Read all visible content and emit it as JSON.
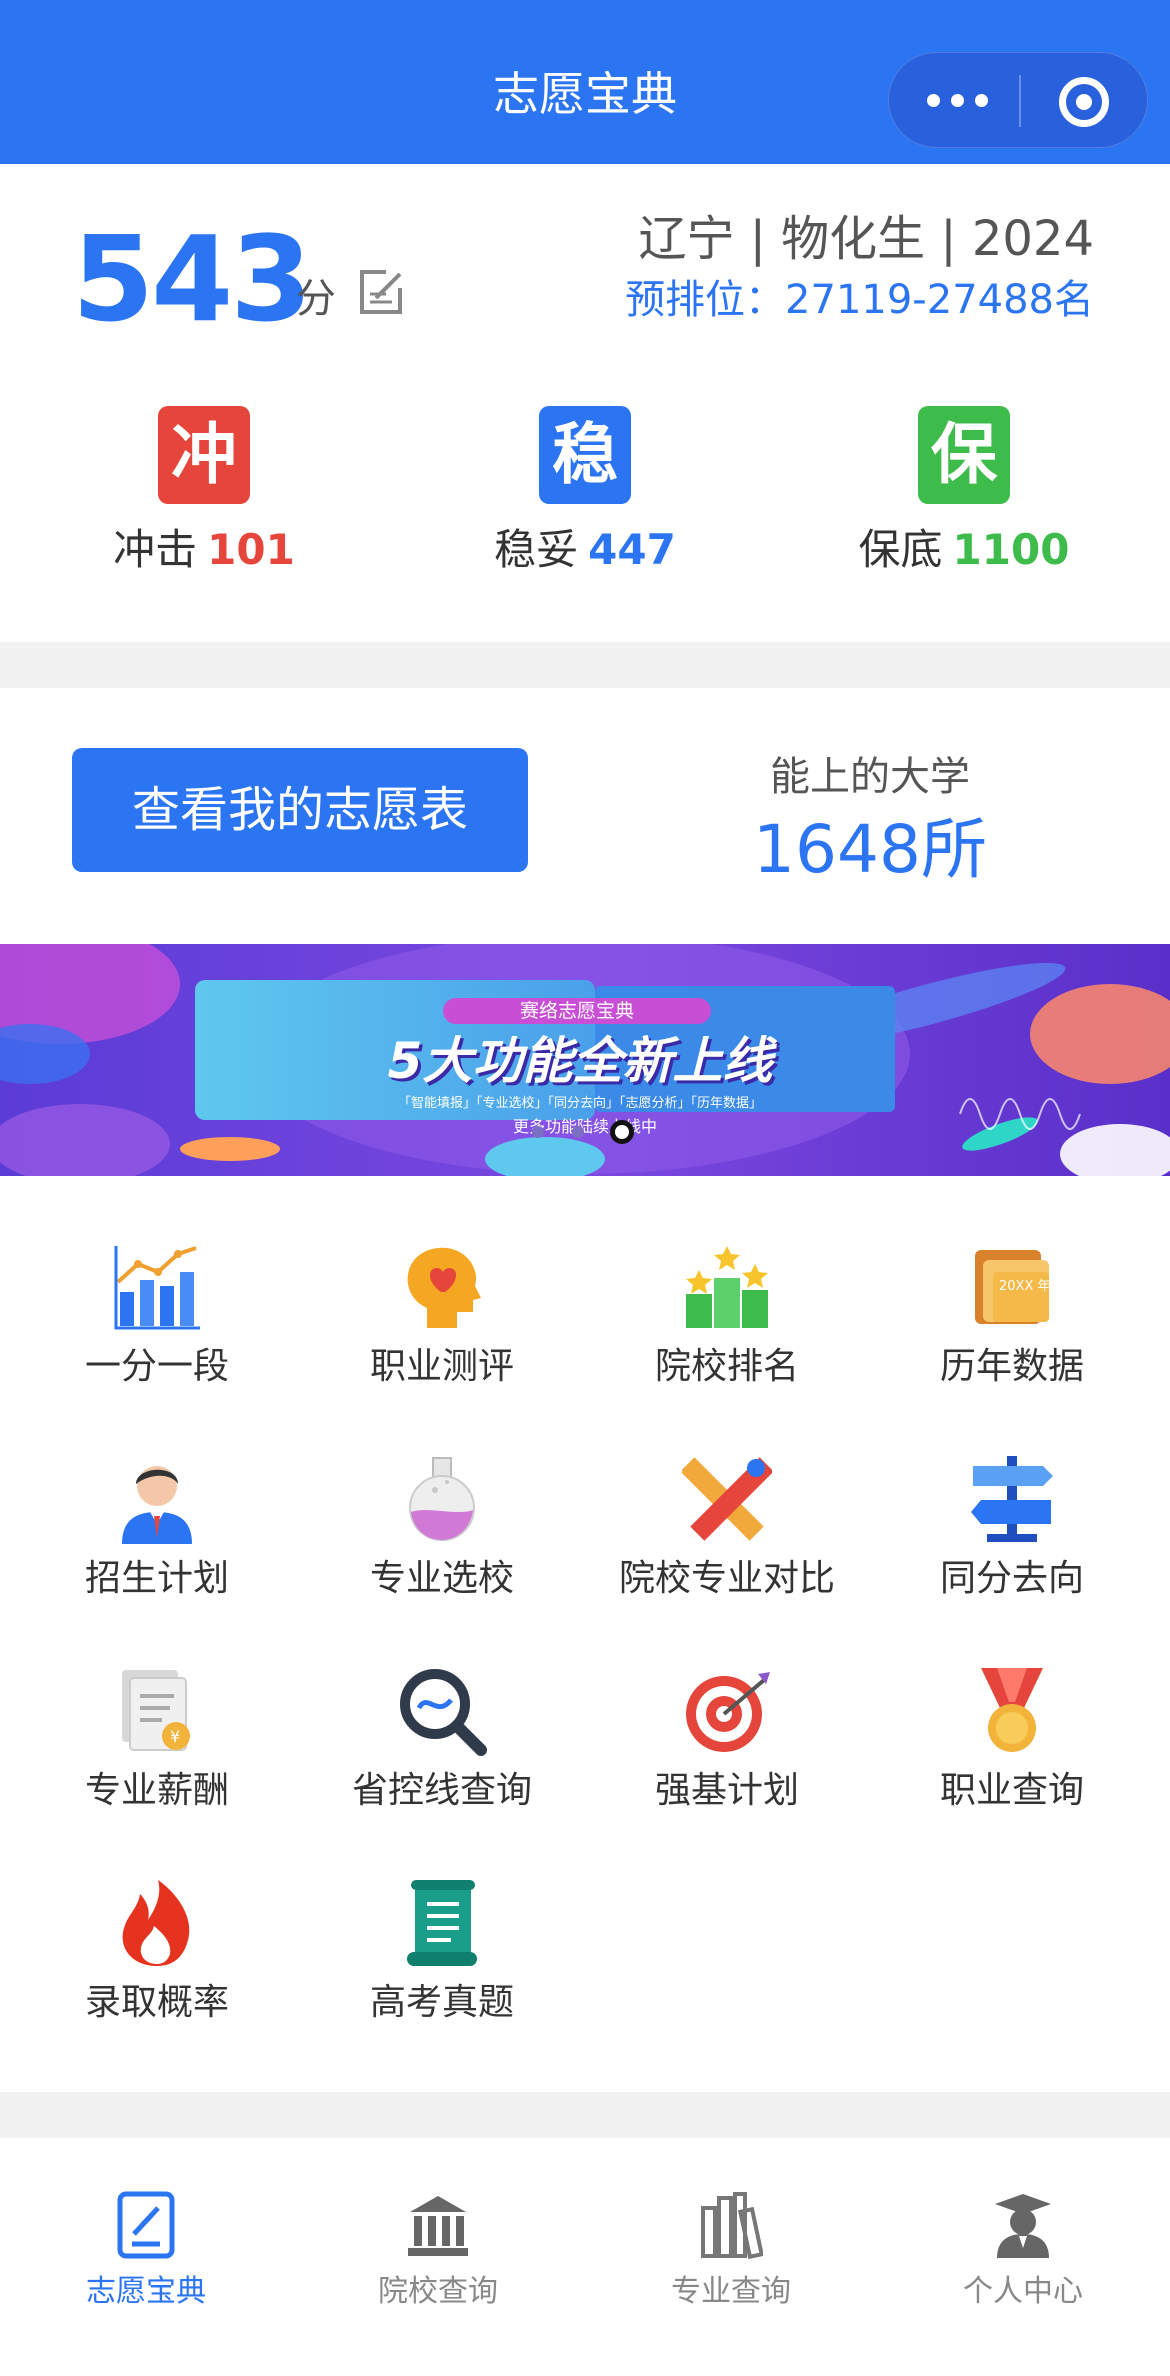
{
  "header": {
    "title": "志愿宝典"
  },
  "score": {
    "value": "543",
    "unit": "分",
    "province_info": "辽宁 | 物化生 | 2024",
    "rank": "预排位：27119-27488名"
  },
  "categories": [
    {
      "badge": "冲",
      "label": "冲击",
      "count": "101",
      "color": "#e5453a"
    },
    {
      "badge": "稳",
      "label": "稳妥",
      "count": "447",
      "color": "#2b74f2"
    },
    {
      "badge": "保",
      "label": "保底",
      "count": "1100",
      "color": "#3dbb4b"
    }
  ],
  "volunteer": {
    "button_label": "查看我的志愿表",
    "uni_label": "能上的大学",
    "uni_count": "1648所"
  },
  "banner": {
    "tag": "赛络志愿宝典",
    "title": "5大功能全新上线",
    "subtitle": "「智能填报」「专业选校」「同分去向」「志愿分析」「历年数据」",
    "more": "更多功能陆续上线中",
    "active_dot": 3
  },
  "grid": [
    {
      "label": "一分一段",
      "icon": "chart-icon"
    },
    {
      "label": "职业测评",
      "icon": "head-heart-icon"
    },
    {
      "label": "院校排名",
      "icon": "ranking-icon"
    },
    {
      "label": "历年数据",
      "icon": "folder-icon"
    },
    {
      "label": "招生计划",
      "icon": "person-icon"
    },
    {
      "label": "专业选校",
      "icon": "flask-icon"
    },
    {
      "label": "院校专业对比",
      "icon": "ruler-pencil-icon"
    },
    {
      "label": "同分去向",
      "icon": "signpost-icon"
    },
    {
      "label": "专业薪酬",
      "icon": "salary-doc-icon"
    },
    {
      "label": "省控线查询",
      "icon": "magnifier-icon"
    },
    {
      "label": "强基计划",
      "icon": "target-icon"
    },
    {
      "label": "职业查询",
      "icon": "medal-icon"
    },
    {
      "label": "录取概率",
      "icon": "fire-icon"
    },
    {
      "label": "高考真题",
      "icon": "scroll-icon"
    }
  ],
  "tabs": [
    {
      "label": "志愿宝典",
      "icon": "edit-doc-icon",
      "active": true
    },
    {
      "label": "院校查询",
      "icon": "school-icon",
      "active": false
    },
    {
      "label": "专业查询",
      "icon": "books-icon",
      "active": false
    },
    {
      "label": "个人中心",
      "icon": "graduate-icon",
      "active": false
    }
  ],
  "colors": {
    "primary": "#2b74f2",
    "danger": "#e5453a",
    "success": "#3dbb4b"
  }
}
